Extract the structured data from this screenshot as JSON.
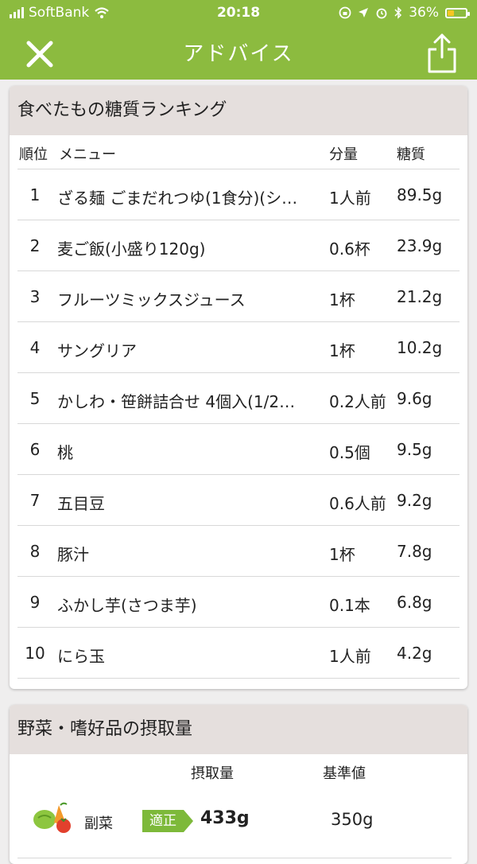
{
  "status_bar": {
    "carrier": "SoftBank",
    "time": "20:18",
    "battery": "36%"
  },
  "nav": {
    "title": "アドバイス"
  },
  "ranking": {
    "title": "食べたもの糖質ランキング",
    "headers": {
      "rank": "順位",
      "menu": "メニュー",
      "quantity": "分量",
      "sugar": "糖質"
    },
    "rows": [
      {
        "rank": "1",
        "menu": "ざる麺 ごまだれつゆ(1食分)(シ…",
        "quantity": "1人前",
        "sugar": "89.5g"
      },
      {
        "rank": "2",
        "menu": "麦ご飯(小盛り120g)",
        "quantity": "0.6杯",
        "sugar": "23.9g"
      },
      {
        "rank": "3",
        "menu": "フルーツミックスジュース",
        "quantity": "1杯",
        "sugar": "21.2g"
      },
      {
        "rank": "4",
        "menu": "サングリア",
        "quantity": "1杯",
        "sugar": "10.2g"
      },
      {
        "rank": "5",
        "menu": "かしわ・笹餅詰合せ 4個入(1/2…",
        "quantity": "0.2人前",
        "sugar": "9.6g"
      },
      {
        "rank": "6",
        "menu": "桃",
        "quantity": "0.5個",
        "sugar": "9.5g"
      },
      {
        "rank": "7",
        "menu": "五目豆",
        "quantity": "0.6人前",
        "sugar": "9.2g"
      },
      {
        "rank": "8",
        "menu": "豚汁",
        "quantity": "1杯",
        "sugar": "7.8g"
      },
      {
        "rank": "9",
        "menu": "ふかし芋(さつま芋)",
        "quantity": "0.1本",
        "sugar": "6.8g"
      },
      {
        "rank": "10",
        "menu": "にら玉",
        "quantity": "1人前",
        "sugar": "4.2g"
      }
    ]
  },
  "vegetables": {
    "title": "野菜・嗜好品の摂取量",
    "headers": {
      "intake": "摂取量",
      "standard": "基準値"
    },
    "items": [
      {
        "label": "副菜",
        "status": "適正",
        "intake": "433g",
        "standard": "350g"
      }
    ]
  },
  "colors": {
    "brand_green": "#8cbb3f",
    "badge_green": "#7db93a",
    "header_bg": "#e5dfdd"
  }
}
